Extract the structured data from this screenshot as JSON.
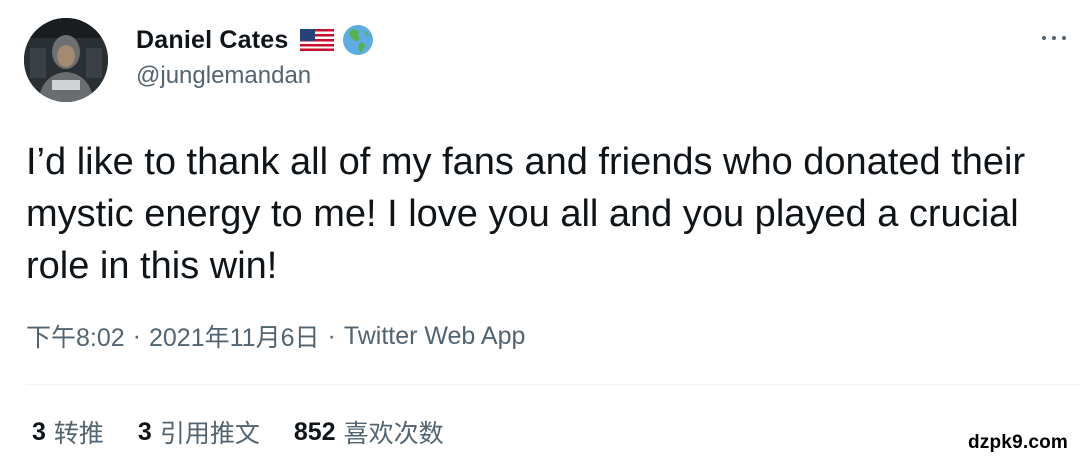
{
  "author": {
    "display_name": "Daniel Cates",
    "handle": "@junglemandan"
  },
  "icons": {
    "flag": "us-flag-icon",
    "globe": "globe-americas-icon",
    "more": "more-horizontal-icon"
  },
  "tweet": {
    "text": "I’d like to thank all of my fans and friends who donated their mystic energy to me! I love you all and you played a crucial role in this win!",
    "time": "下午8:02",
    "separator": "·",
    "date": "2021年11月6日",
    "source": "Twitter Web App"
  },
  "stats": {
    "retweets_count": "3",
    "retweets_label": "转推",
    "quotes_count": "3",
    "quotes_label": "引用推文",
    "likes_count": "852",
    "likes_label": "喜欢次数"
  },
  "watermark": "dzpk9.com",
  "colors": {
    "text": "#0f1419",
    "secondary": "#536471",
    "divider": "#eff3f4"
  }
}
